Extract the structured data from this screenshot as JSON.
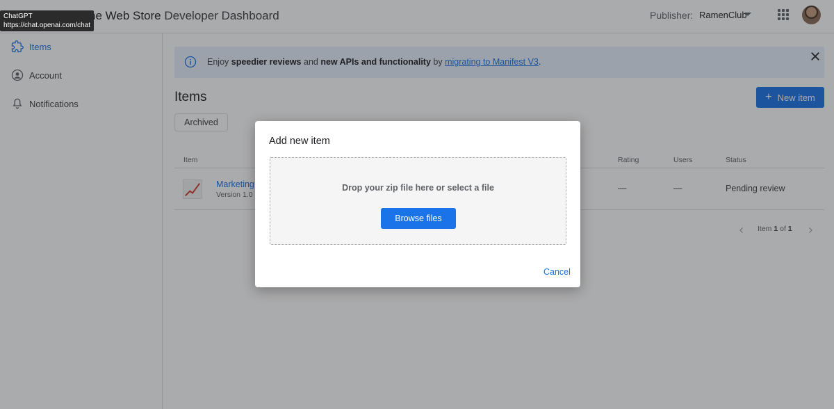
{
  "tooltip": {
    "title": "ChatGPT",
    "url": "https://chat.openai.com/chat"
  },
  "header": {
    "title_strong": "he Web Store",
    "title_rest": " Developer Dashboard",
    "publisher_label": "Publisher:",
    "publisher_value": "RamenClub"
  },
  "sidebar": {
    "items": [
      {
        "label": "Items",
        "icon": "puzzle-icon",
        "active": true
      },
      {
        "label": "Account",
        "icon": "account-circle-icon"
      },
      {
        "label": "Notifications",
        "icon": "bell-icon"
      }
    ]
  },
  "banner": {
    "t1": "Enjoy ",
    "b1": "speedier reviews",
    "t2": " and ",
    "b2": "new APIs and functionality",
    "t3": " by ",
    "link": "migrating to Manifest V3",
    "t4": "."
  },
  "main": {
    "title": "Items",
    "new_item_label": "New item",
    "filter_chip": "Archived"
  },
  "table": {
    "columns": [
      "Item",
      "Rating",
      "Users",
      "Status"
    ],
    "rows": [
      {
        "name": "Marketing",
        "version": "Version 1.0",
        "rating": "—",
        "users": "—",
        "status": "Pending review"
      }
    ]
  },
  "pagination": {
    "prefix": "Item ",
    "current": "1",
    "middle": " of ",
    "total": "1"
  },
  "dialog": {
    "title": "Add new item",
    "drop_text": "Drop your zip file here or select a file",
    "browse_label": "Browse files",
    "cancel_label": "Cancel"
  },
  "colors": {
    "accent": "#1a73e8",
    "banner_bg": "#e8f0fe"
  }
}
